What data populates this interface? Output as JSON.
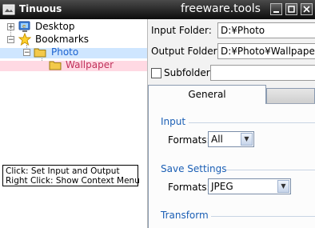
{
  "app": {
    "title": "Tinuous",
    "site": "freeware.tools"
  },
  "tree": {
    "items": [
      {
        "label": "Desktop",
        "icon": "desktop-icon",
        "expander": "+"
      },
      {
        "label": "Bookmarks",
        "icon": "star-icon",
        "expander": "−"
      },
      {
        "label": "Photo",
        "icon": "folder-icon",
        "expander": "−"
      },
      {
        "label": "Wallpaper",
        "icon": "folder-icon"
      }
    ],
    "tooltip": {
      "line1": "Click: Set Input and Output",
      "line2": "Right Click: Show Context Menu"
    }
  },
  "form": {
    "input_folder_label": "Input Folder:",
    "input_folder_value": "D:¥Photo",
    "output_folder_label": "Output Folder:",
    "output_folder_value": "D:¥Photo¥Wallpaper",
    "subfolder_label": "Subfolder:",
    "subfolder_checked": false
  },
  "tabs": {
    "general": "General"
  },
  "sections": {
    "input": {
      "title": "Input",
      "formats_label": "Formats:",
      "formats_value": "All"
    },
    "save": {
      "title": "Save Settings",
      "formats_label": "Formats:",
      "formats_value": "JPEG"
    },
    "transform": {
      "title": "Transform"
    }
  },
  "colors": {
    "photo_highlight": "#cfe6ff",
    "wallpaper_highlight": "#ffd9e3",
    "section_blue": "#1b5fb5",
    "wallpaper_text": "#c0305a",
    "photo_text": "#1a62d0"
  }
}
